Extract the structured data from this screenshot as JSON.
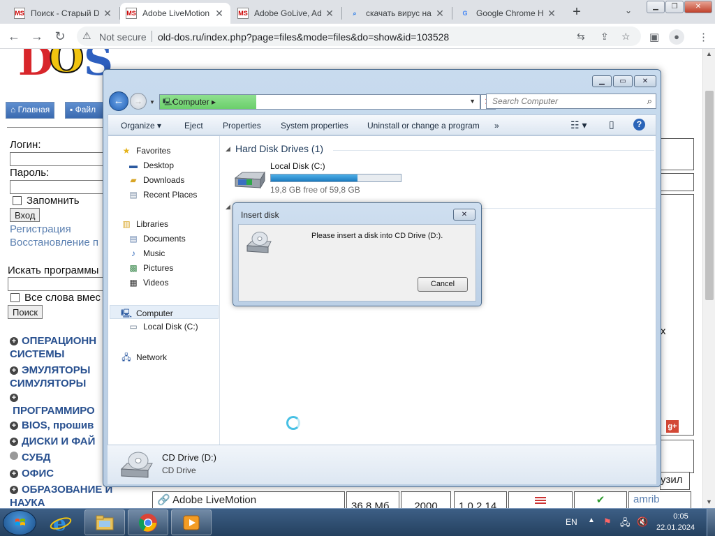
{
  "browser": {
    "tabs": [
      {
        "title": "Поиск - Старый D",
        "icon": "ms-icon",
        "active": false
      },
      {
        "title": "Adobe LiveMotion",
        "icon": "ms-icon",
        "active": true
      },
      {
        "title": "Adobe GoLive, Ad",
        "icon": "ms-icon",
        "active": false
      },
      {
        "title": "скачать вирус на",
        "icon": "search-icon",
        "active": false
      },
      {
        "title": "Google Chrome H",
        "icon": "google-icon",
        "active": false
      }
    ],
    "new_tab_label": "+",
    "security_label": "Not secure",
    "url": "old-dos.ru/index.php?page=files&mode=files&do=show&id=103528"
  },
  "site": {
    "logo_text": "DOS",
    "nav_home": "Главная",
    "nav_files": "Файл",
    "login_label": "Логин:",
    "password_label": "Пароль:",
    "remember_label": "Запомнить",
    "login_button": "Вход",
    "register_link": "Регистрация",
    "restore_link": "Восстановление п",
    "search_label": "Искать программы",
    "all_words_label": "Все слова вмес",
    "search_button": "Поиск",
    "categories": [
      {
        "label": "ОПЕРАЦИОНН\nСИСТЕМЫ",
        "marker": "plus"
      },
      {
        "label": "ЭМУЛЯТОРЫ\nСИМУЛЯТОРЫ",
        "marker": "plus"
      },
      {
        "label": "ПРОГРАММИРО",
        "marker": "plus"
      },
      {
        "label": "BIOS, прошив",
        "marker": "plus"
      },
      {
        "label": "ДИСКИ И ФАЙ",
        "marker": "plus"
      },
      {
        "label": "СУБД",
        "marker": "circle"
      },
      {
        "label": "ОФИС",
        "marker": "plus"
      },
      {
        "label": "ОБРАЗОВАНИЕ И\nНАУКА",
        "marker": "plus"
      }
    ],
    "behind_text_right": "х",
    "behind_text_uzil": "узил",
    "bottom_row": {
      "name": "Adobe LiveMotion",
      "size": "36,8 Мб",
      "year": "2000",
      "version": "1.0.2.14",
      "user": "amrib"
    }
  },
  "explorer": {
    "address_crumb": "Computer",
    "search_placeholder": "Search Computer",
    "commands": [
      "Organize",
      "Eject",
      "Properties",
      "System properties",
      "Uninstall or change a program",
      "»"
    ],
    "nav": {
      "favorites": "Favorites",
      "desktop": "Desktop",
      "downloads": "Downloads",
      "recent": "Recent Places",
      "libraries": "Libraries",
      "documents": "Documents",
      "music": "Music",
      "pictures": "Pictures",
      "videos": "Videos",
      "computer": "Computer",
      "local_disk": "Local Disk (C:)",
      "network": "Network"
    },
    "hdd_section_title": "Hard Disk Drives (1)",
    "drive": {
      "name": "Local Disk (C:)",
      "free_text": "19,8 GB free of 59,8 GB",
      "used_fraction": 0.669
    },
    "details": {
      "name": "CD Drive (D:)",
      "type": "CD Drive"
    }
  },
  "dialog": {
    "title": "Insert disk",
    "message": "Please insert a disk into CD Drive (D:).",
    "cancel_label": "Cancel"
  },
  "taskbar": {
    "language": "EN",
    "time": "0:05",
    "date": "22.01.2024"
  }
}
